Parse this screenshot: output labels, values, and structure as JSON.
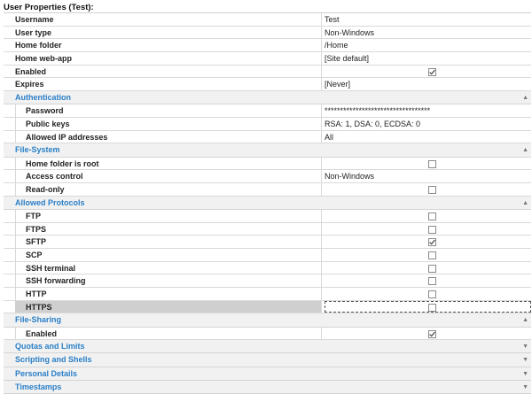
{
  "title": "User Properties (Test):",
  "general": [
    {
      "label": "Username",
      "value": "Test"
    },
    {
      "label": "User type",
      "value": "Non-Windows"
    },
    {
      "label": "Home folder",
      "value": "/Home"
    },
    {
      "label": "Home web-app",
      "value": "[Site default]"
    },
    {
      "label": "Enabled",
      "checked": true
    },
    {
      "label": "Expires",
      "value": "[Never]"
    }
  ],
  "authentication": {
    "category": "Authentication",
    "rows": [
      {
        "label": "Password",
        "value": "**********************************"
      },
      {
        "label": "Public keys",
        "value": "RSA: 1, DSA: 0, ECDSA: 0"
      },
      {
        "label": "Allowed IP addresses",
        "value": "All"
      }
    ]
  },
  "file_system": {
    "category": "File-System",
    "rows": [
      {
        "label": "Home folder is root",
        "checked": false
      },
      {
        "label": "Access control",
        "value": "Non-Windows"
      },
      {
        "label": "Read-only",
        "checked": false
      }
    ]
  },
  "allowed_protocols": {
    "category": "Allowed Protocols",
    "rows": [
      {
        "label": "FTP",
        "checked": false
      },
      {
        "label": "FTPS",
        "checked": false
      },
      {
        "label": "SFTP",
        "checked": true
      },
      {
        "label": "SCP",
        "checked": false
      },
      {
        "label": "SSH terminal",
        "checked": false
      },
      {
        "label": "SSH forwarding",
        "checked": false
      },
      {
        "label": "HTTP",
        "checked": false
      },
      {
        "label": "HTTPS",
        "checked": false,
        "selected": true
      }
    ]
  },
  "file_sharing": {
    "category": "File-Sharing",
    "rows": [
      {
        "label": "Enabled",
        "checked": true
      }
    ]
  },
  "collapsed_categories": [
    "Quotas and Limits",
    "Scripting and Shells",
    "Personal Details",
    "Timestamps"
  ],
  "icons": {
    "expanded": "collapse-arrow-icon",
    "collapsed": "expand-arrow-icon",
    "check": "check-icon"
  },
  "colors": {
    "category_text": "#2a7fc7",
    "category_bg": "#f1f1f1",
    "selected_bg": "#cfcfcf"
  }
}
